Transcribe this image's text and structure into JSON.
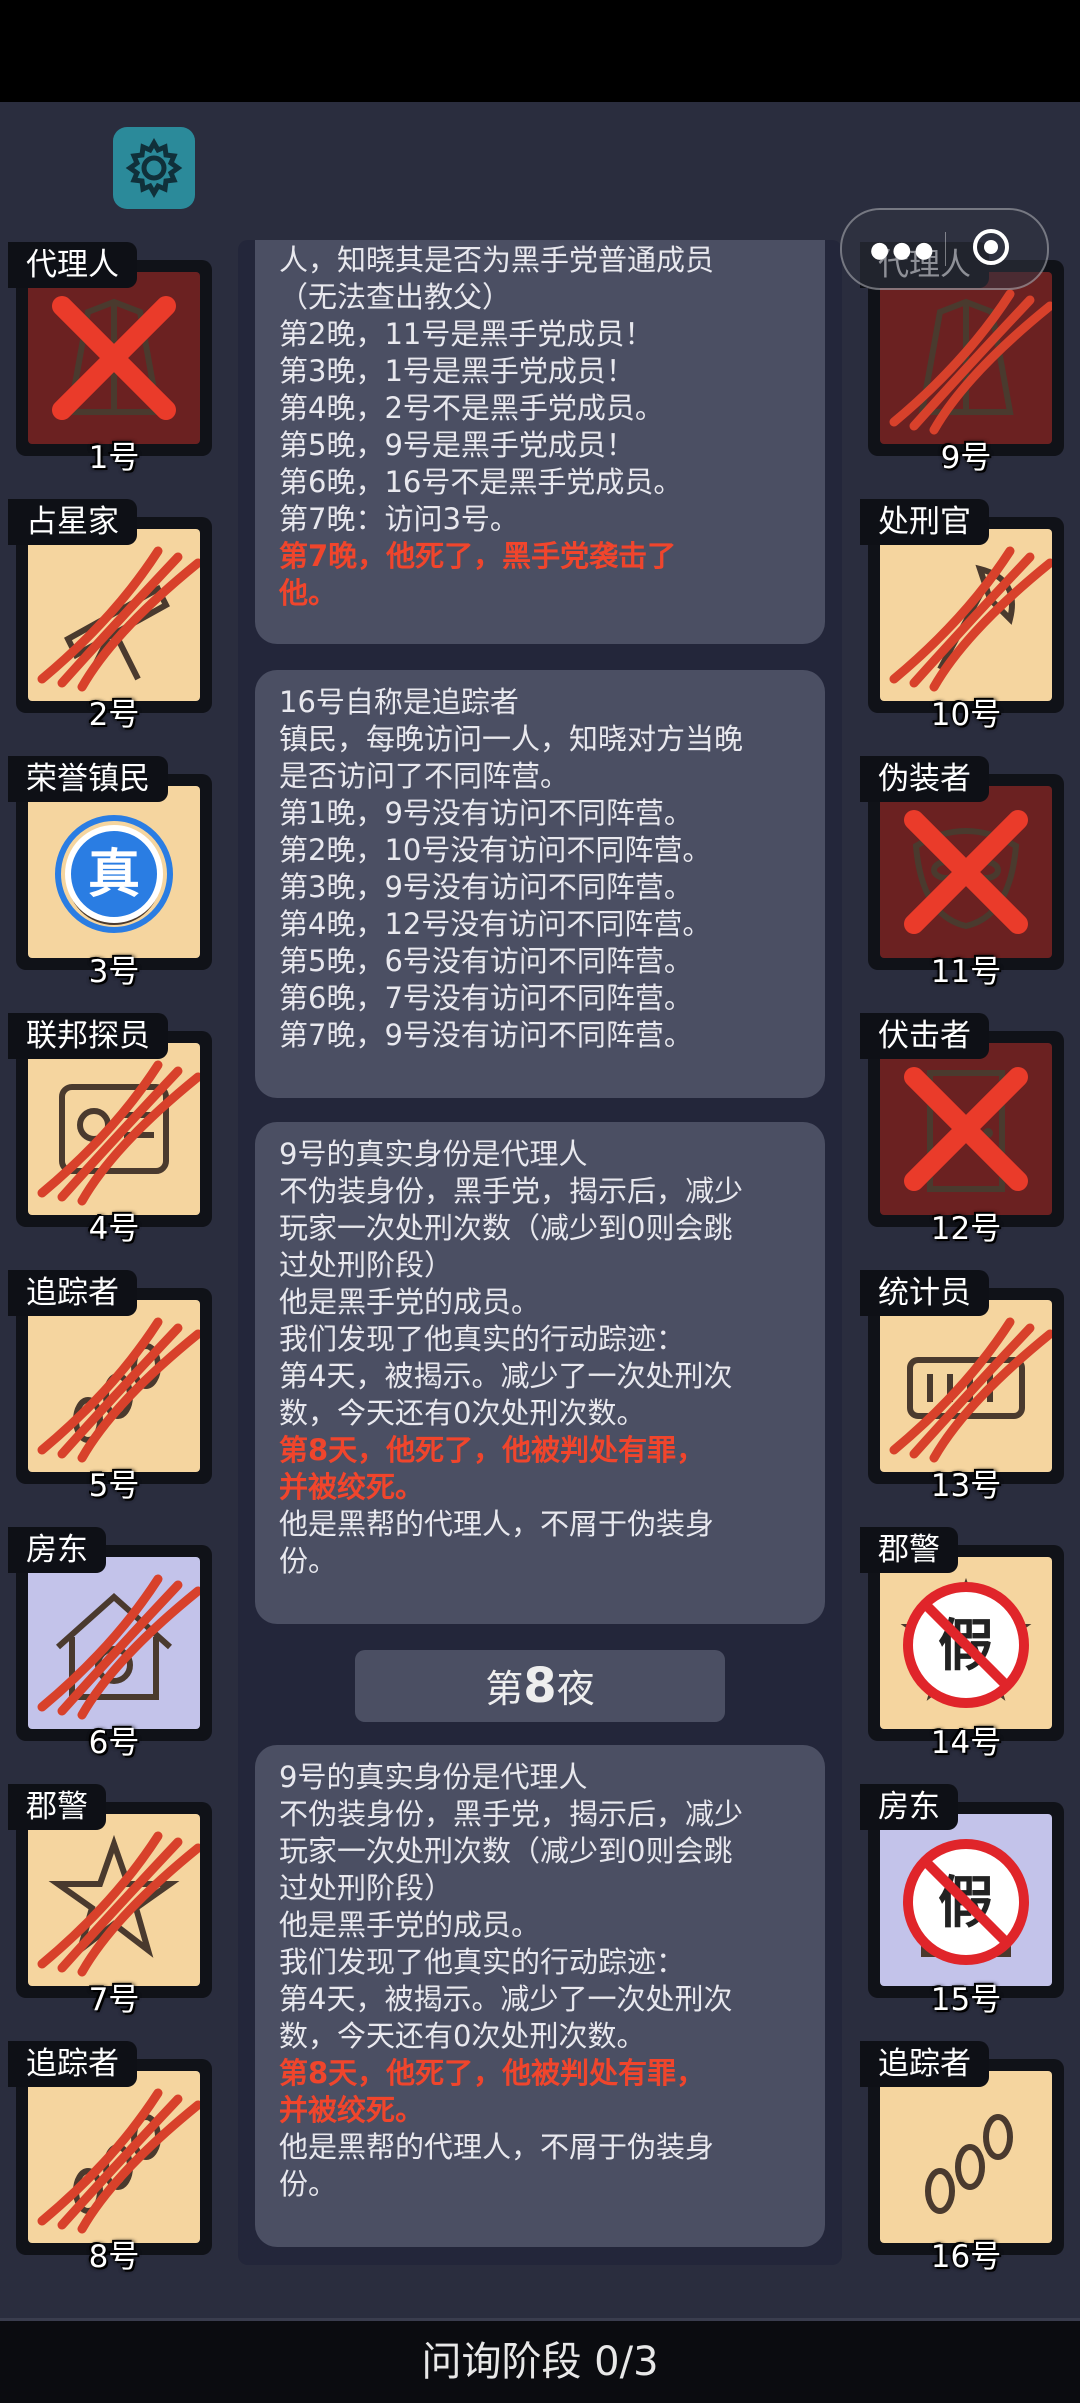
{
  "toolbar": {
    "settings_icon": "gear-icon",
    "menu_icon": "more-dots-icon",
    "close_icon": "target-icon"
  },
  "players": [
    {
      "num": "1号",
      "role": "代理人",
      "bg": "#6b2121",
      "status": "dead-x",
      "icon": "coat-icon"
    },
    {
      "num": "2号",
      "role": "占星家",
      "bg": "#f5d59f",
      "status": "dead-claw",
      "icon": "telescope-icon"
    },
    {
      "num": "3号",
      "role": "荣誉镇民",
      "bg": "#f5d59f",
      "status": "verified",
      "icon": "medal-icon",
      "badge": "真"
    },
    {
      "num": "4号",
      "role": "联邦探员",
      "bg": "#f5d59f",
      "status": "dead-claw",
      "icon": "badge-card-icon"
    },
    {
      "num": "5号",
      "role": "追踪者",
      "bg": "#f5d59f",
      "status": "dead-claw",
      "icon": "footprints-icon"
    },
    {
      "num": "6号",
      "role": "房东",
      "bg": "#c3c3ea",
      "status": "dead-claw",
      "icon": "house-icon"
    },
    {
      "num": "7号",
      "role": "郡警",
      "bg": "#f5d59f",
      "status": "dead-claw",
      "icon": "sheriff-star-icon"
    },
    {
      "num": "8号",
      "role": "追踪者",
      "bg": "#f5d59f",
      "status": "dead-claw",
      "icon": "footprints-icon"
    },
    {
      "num": "9号",
      "role": "代理人",
      "bg": "#6b2121",
      "status": "dead-claw",
      "icon": "coat-icon"
    },
    {
      "num": "10号",
      "role": "处刑官",
      "bg": "#f5d59f",
      "status": "dead-claw",
      "icon": "axe-icon"
    },
    {
      "num": "11号",
      "role": "伪装者",
      "bg": "#6b2121",
      "status": "dead-x",
      "icon": "mask-icon"
    },
    {
      "num": "12号",
      "role": "伏击者",
      "bg": "#6b2121",
      "status": "dead-x",
      "icon": "door-icon"
    },
    {
      "num": "13号",
      "role": "统计员",
      "bg": "#f5d59f",
      "status": "dead-claw",
      "icon": "counter-icon"
    },
    {
      "num": "14号",
      "role": "郡警",
      "bg": "#f5d59f",
      "status": "fake",
      "icon": "sheriff-star-icon",
      "badge": "假"
    },
    {
      "num": "15号",
      "role": "房东",
      "bg": "#c3c3ea",
      "status": "fake",
      "icon": "house-icon",
      "badge": "假"
    },
    {
      "num": "16号",
      "role": "追踪者",
      "bg": "#f5d59f",
      "status": "alive",
      "icon": "footprints-icon"
    }
  ],
  "logs": [
    {
      "lines": [
        {
          "t": "人，知晓其是否为黑手党普通成员"
        },
        {
          "t": "（无法查出教父）"
        },
        {
          "t": "第2晚，11号是黑手党成员！"
        },
        {
          "t": "第3晚，1号是黑手党成员！"
        },
        {
          "t": "第4晚，2号不是黑手党成员。"
        },
        {
          "t": "第5晚，9号是黑手党成员！"
        },
        {
          "t": "第6晚，16号不是黑手党成员。"
        },
        {
          "t": "第7晚：访问3号。"
        },
        {
          "t": "第7晚，他死了，黑手党袭击了",
          "red": true
        },
        {
          "t": "他。",
          "red": true
        }
      ]
    },
    {
      "lines": [
        {
          "t": "16号自称是追踪者"
        },
        {
          "t": "镇民，每晚访问一人，知晓对方当晚"
        },
        {
          "t": "是否访问了不同阵营。"
        },
        {
          "t": "第1晚，9号没有访问不同阵营。"
        },
        {
          "t": "第2晚，10号没有访问不同阵营。"
        },
        {
          "t": "第3晚，9号没有访问不同阵营。"
        },
        {
          "t": "第4晚，12号没有访问不同阵营。"
        },
        {
          "t": "第5晚，6号没有访问不同阵营。"
        },
        {
          "t": "第6晚，7号没有访问不同阵营。"
        },
        {
          "t": "第7晚，9号没有访问不同阵营。"
        }
      ]
    },
    {
      "lines": [
        {
          "t": "9号的真实身份是代理人"
        },
        {
          "t": "不伪装身份，黑手党，揭示后，减少"
        },
        {
          "t": "玩家一次处刑次数（减少到0则会跳"
        },
        {
          "t": "过处刑阶段）"
        },
        {
          "t": "他是黑手党的成员。"
        },
        {
          "t": "我们发现了他真实的行动踪迹："
        },
        {
          "t": "第4天，被揭示。减少了一次处刑次"
        },
        {
          "t": "数，今天还有0次处刑次数。"
        },
        {
          "t": "第8天，他死了，他被判处有罪，",
          "red": true
        },
        {
          "t": "并被绞死。",
          "red": true
        },
        {
          "t": "他是黑帮的代理人，不屑于伪装身"
        },
        {
          "t": "份。"
        }
      ]
    },
    {
      "lines": [
        {
          "t": "9号的真实身份是代理人"
        },
        {
          "t": "不伪装身份，黑手党，揭示后，减少"
        },
        {
          "t": "玩家一次处刑次数（减少到0则会跳"
        },
        {
          "t": "过处刑阶段）"
        },
        {
          "t": "他是黑手党的成员。"
        },
        {
          "t": "我们发现了他真实的行动踪迹："
        },
        {
          "t": "第4天，被揭示。减少了一次处刑次"
        },
        {
          "t": "数，今天还有0次处刑次数。"
        },
        {
          "t": "第8天，他死了，他被判处有罪，",
          "red": true
        },
        {
          "t": "并被绞死。",
          "red": true
        },
        {
          "t": "他是黑帮的代理人，不屑于伪装身"
        },
        {
          "t": "份。"
        }
      ]
    }
  ],
  "night": {
    "prefix": "第",
    "number": "8",
    "suffix": "夜"
  },
  "phase": {
    "label": "问询阶段 0/3"
  }
}
